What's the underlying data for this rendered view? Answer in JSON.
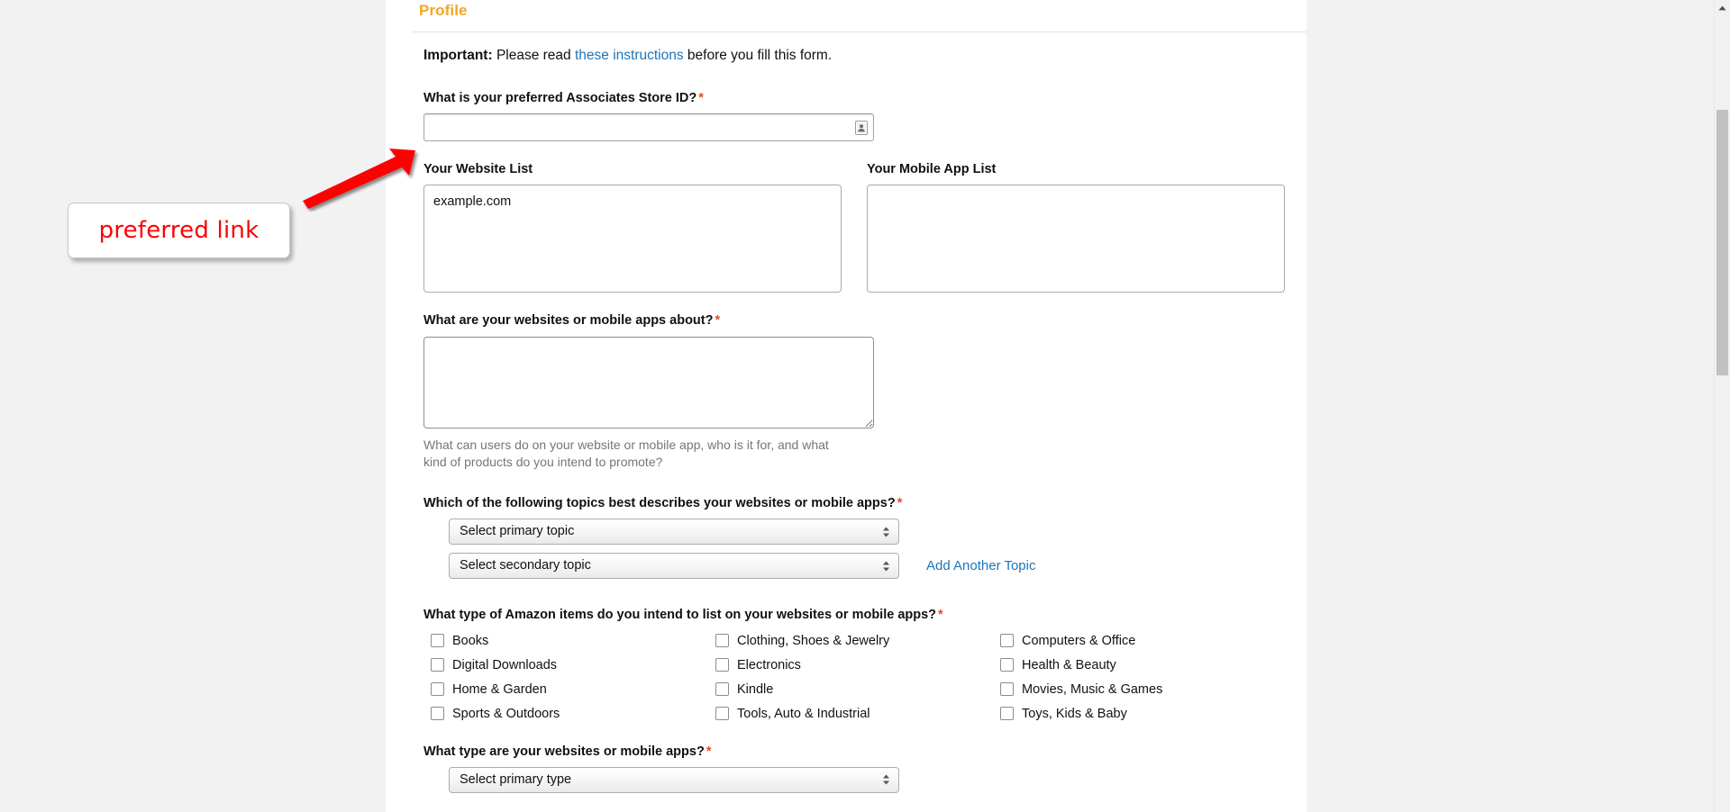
{
  "card": {
    "title": "Profile"
  },
  "notice": {
    "important_label": "Important:",
    "text_before": " Please read ",
    "link_text": "these instructions",
    "text_after": " before you fill this form."
  },
  "fields": {
    "store_id": {
      "label": "What is your preferred Associates Store ID?",
      "required_mark": "*",
      "value": "",
      "placeholder": "",
      "icon": "id-card-icon"
    },
    "website_list": {
      "label": "Your Website List",
      "value": "example.com"
    },
    "mobile_app_list": {
      "label": "Your Mobile App List",
      "value": ""
    },
    "about": {
      "label": "What are your websites or mobile apps about?",
      "required_mark": "*",
      "value": "",
      "placeholder": "",
      "helper": "What can users do on your website or mobile app, who is it for, and what kind of products do you intend to promote?"
    },
    "topics": {
      "label": "Which of the following topics best describes your websites or mobile apps?",
      "required_mark": "*",
      "primary_value": "Select primary topic",
      "secondary_value": "Select secondary topic",
      "add_another_label": "Add Another Topic"
    },
    "items": {
      "label": "What type of Amazon items do you intend to list on your websites or mobile apps?",
      "required_mark": "*",
      "options": [
        "Books",
        "Clothing, Shoes & Jewelry",
        "Computers & Office",
        "Digital Downloads",
        "Electronics",
        "Health & Beauty",
        "Home & Garden",
        "Kindle",
        "Movies, Music & Games",
        "Sports & Outdoors",
        "Tools, Auto & Industrial",
        "Toys, Kids & Baby"
      ]
    },
    "site_type": {
      "label": "What type are your websites or mobile apps?",
      "required_mark": "*",
      "primary_value": "Select primary type"
    }
  },
  "annotation": {
    "callout_text": "preferred link",
    "callout_color": "#ff0000",
    "arrow_color": "#ff0000"
  },
  "colors": {
    "title_orange": "#f5a623",
    "link_blue": "#1b75bb",
    "required_red": "#e8472b",
    "helper_gray": "#767676"
  }
}
